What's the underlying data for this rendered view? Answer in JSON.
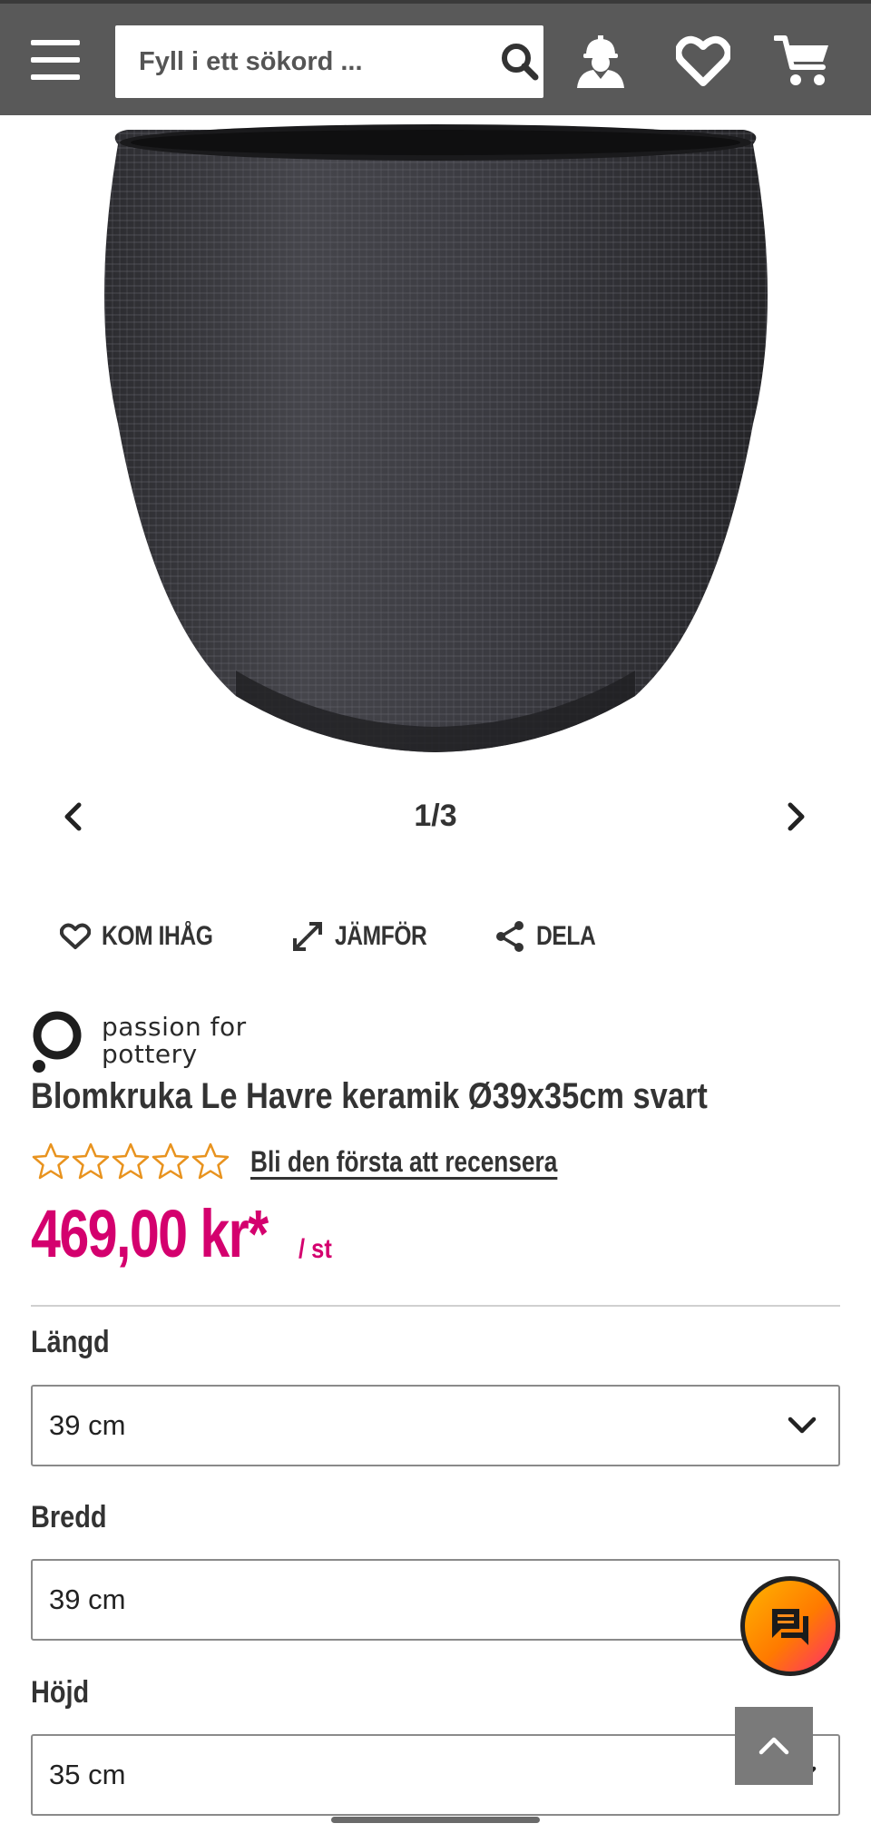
{
  "header": {
    "search_placeholder": "Fyll i ett sökord ...",
    "icons": [
      "menu-icon",
      "search-icon",
      "account-icon",
      "wishlist-heart-icon",
      "cart-icon"
    ],
    "background_color": "#595959"
  },
  "gallery": {
    "counter": "1/3",
    "image": "black textured ceramic flower pot"
  },
  "actions": {
    "remember": "KOM IHÅG",
    "compare": "JÄMFÖR",
    "share": "DELA"
  },
  "product": {
    "brand_line1": "passion for",
    "brand_line2": "pottery",
    "title": "Blomkruka Le Havre keramik Ø39x35cm svart",
    "review_link": "Bli den första att recensera",
    "rating": 0,
    "rating_max": 5,
    "price": "469,00 kr*",
    "price_unit": "/ st",
    "price_color": "#d4006e",
    "star_color": "#e8931f"
  },
  "options": {
    "length_label": "Längd",
    "length_value": "39 cm",
    "width_label": "Bredd",
    "width_value": "39 cm",
    "height_label": "Höjd",
    "height_value": "35 cm"
  }
}
